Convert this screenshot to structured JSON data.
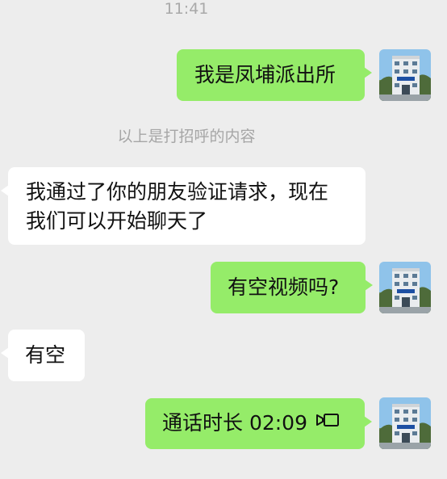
{
  "status_bar": {
    "time": "11:41"
  },
  "system_note": "以上是打招呼的内容",
  "messages": [
    {
      "text": "我是凤埔派出所"
    },
    {
      "line1": "我通过了你的朋友验证请求，现在",
      "line2": "我们可以开始聊天了"
    },
    {
      "text": "有空视频吗?"
    },
    {
      "text": "有空"
    },
    {
      "text": "通话时长 02:09",
      "icon": "video-call-icon"
    }
  ],
  "colors": {
    "background": "#ededed",
    "outgoing_bubble": "#95ec69",
    "incoming_bubble": "#ffffff",
    "meta_text": "#a6a6a6"
  },
  "avatar": {
    "icon": "police-station-building-avatar"
  }
}
